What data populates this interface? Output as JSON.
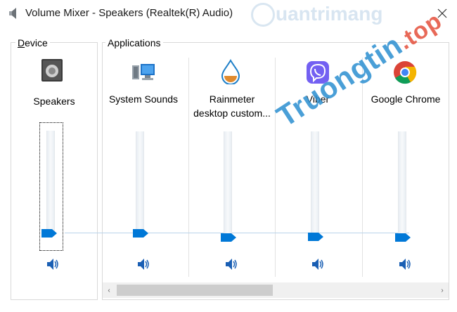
{
  "window": {
    "title": "Volume Mixer - Speakers (Realtek(R) Audio)",
    "icon": "speaker-icon",
    "close_icon": "close-icon"
  },
  "watermark": {
    "top_text": "uantrimang",
    "diag_text": "Truongtin",
    "diag_tld": ".top"
  },
  "device": {
    "group_label_first": "D",
    "group_label_rest": "evice",
    "name": "Speakers",
    "icon": "speaker-device-icon",
    "volume": 0.0,
    "muted": false
  },
  "applications": {
    "group_label": "Applications",
    "items": [
      {
        "name": "System Sounds",
        "icon": "system-sounds-icon",
        "volume": 0.0
      },
      {
        "name_line1": "Rainmeter",
        "name_line2": "desktop custom...",
        "icon": "rainmeter-icon",
        "volume": 0.0
      },
      {
        "name": "Viber",
        "icon": "viber-icon",
        "volume": 0.0
      },
      {
        "name": "Google Chrome",
        "icon": "chrome-icon",
        "volume": 0.0
      }
    ]
  },
  "scrollbar": {
    "left_arrow": "‹",
    "right_arrow": "›",
    "position": 0.0
  },
  "colors": {
    "accent": "#0078d7",
    "groove": "#e9eef3",
    "border": "#d9d9d9"
  }
}
